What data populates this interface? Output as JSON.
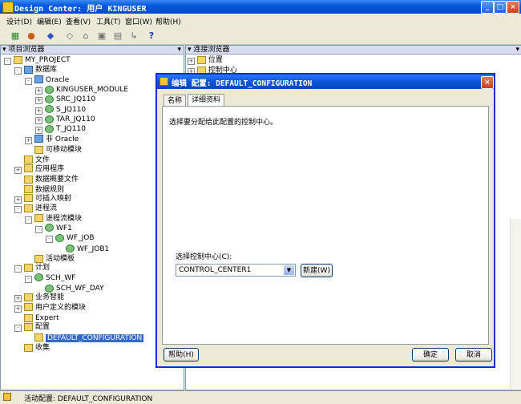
{
  "window": {
    "title": "Design Center: 用户 KINGUSER"
  },
  "menu": [
    "设计(D)",
    "编辑(E)",
    "查看(V)",
    "工具(T)",
    "窗口(W)",
    "帮助(H)"
  ],
  "left_pane": {
    "title": "项目浏览器"
  },
  "right_pane": {
    "title": "连接浏览器",
    "items": [
      "位置",
      "控制中心"
    ]
  },
  "tree": [
    {
      "label": "MY_PROJECT",
      "level": 0,
      "exp": "-",
      "icon": "folder"
    },
    {
      "label": "数据库",
      "level": 1,
      "exp": "-",
      "icon": "db"
    },
    {
      "label": "Oracle",
      "level": 2,
      "exp": "-",
      "icon": "db"
    },
    {
      "label": "KINGUSER_MODULE",
      "level": 3,
      "exp": "+",
      "icon": "mod"
    },
    {
      "label": "SRC_JQ110",
      "level": 3,
      "exp": "+",
      "icon": "mod"
    },
    {
      "label": "S_JQ110",
      "level": 3,
      "exp": "+",
      "icon": "mod"
    },
    {
      "label": "TAR_JQ110",
      "level": 3,
      "exp": "+",
      "icon": "mod"
    },
    {
      "label": "T_JQ110",
      "level": 3,
      "exp": "+",
      "icon": "mod"
    },
    {
      "label": "非 Oracle",
      "level": 2,
      "exp": "+",
      "icon": "db"
    },
    {
      "label": "可移动模块",
      "level": 2,
      "exp": "",
      "icon": "folder"
    },
    {
      "label": "文件",
      "level": 1,
      "exp": "",
      "icon": "folder"
    },
    {
      "label": "应用程序",
      "level": 1,
      "exp": "+",
      "icon": "folder"
    },
    {
      "label": "数据概要文件",
      "level": 1,
      "exp": "",
      "icon": "folder"
    },
    {
      "label": "数据规则",
      "level": 1,
      "exp": "",
      "icon": "folder"
    },
    {
      "label": "可插入映射",
      "level": 1,
      "exp": "+",
      "icon": "folder"
    },
    {
      "label": "进程流",
      "level": 1,
      "exp": "-",
      "icon": "folder"
    },
    {
      "label": "进程流模块",
      "level": 2,
      "exp": "-",
      "icon": "folder"
    },
    {
      "label": "WF1",
      "level": 3,
      "exp": "-",
      "icon": "mod"
    },
    {
      "label": "WF_JOB",
      "level": 4,
      "exp": "-",
      "icon": "mod"
    },
    {
      "label": "WF_JOB1",
      "level": 5,
      "exp": "",
      "icon": "mod"
    },
    {
      "label": "活动模板",
      "level": 2,
      "exp": "",
      "icon": "folder"
    },
    {
      "label": "计划",
      "level": 1,
      "exp": "-",
      "icon": "folder"
    },
    {
      "label": "SCH_WF",
      "level": 2,
      "exp": "-",
      "icon": "mod"
    },
    {
      "label": "SCH_WF_DAY",
      "level": 3,
      "exp": "",
      "icon": "mod"
    },
    {
      "label": "业务智能",
      "level": 1,
      "exp": "+",
      "icon": "folder"
    },
    {
      "label": "用户定义的模块",
      "level": 1,
      "exp": "+",
      "icon": "folder"
    },
    {
      "label": "Expert",
      "level": 1,
      "exp": "",
      "icon": "folder"
    },
    {
      "label": "配置",
      "level": 1,
      "exp": "-",
      "icon": "folder"
    },
    {
      "label": "DEFAULT_CONFIGURATION",
      "level": 2,
      "exp": "",
      "icon": "folder",
      "selected": true
    },
    {
      "label": "收集",
      "level": 1,
      "exp": "",
      "icon": "folder"
    }
  ],
  "status": {
    "text": "活动配置: DEFAULT_CONFIGURATION"
  },
  "dialog": {
    "title": "编辑 配置: DEFAULT_CONFIGURATION",
    "tabs": [
      "名称",
      "详细资料"
    ],
    "instruction": "选择要分配给此配置的控制中心。",
    "select_label": "选择控制中心(C):",
    "select_value": "CONTROL_CENTER1",
    "new_button": "新建(W)",
    "help_button": "帮助(H)",
    "ok_button": "确定",
    "cancel_button": "取消"
  }
}
